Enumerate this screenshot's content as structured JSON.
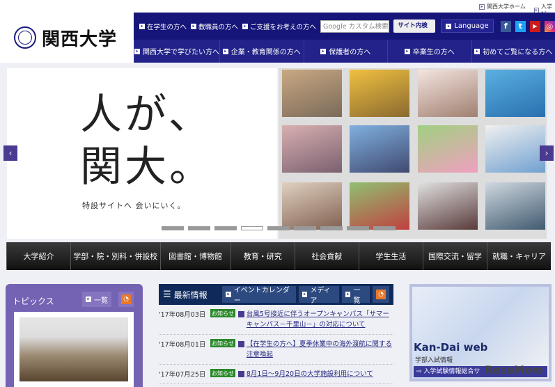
{
  "top_links": [
    "関西大学ホーム",
    "入学試"
  ],
  "logo": {
    "text": "関西大学"
  },
  "nav1": {
    "links": [
      "在学生の方へ",
      "教職員の方へ",
      "ご支援をお考えの方へ"
    ],
    "search_placeholder": "Google カスタム検索",
    "search_button": "サイト内検索",
    "language": "Language",
    "social": [
      "f",
      "t",
      "▶",
      "◎"
    ]
  },
  "nav2": [
    "関西大学で学びたい方へ",
    "企業・教育関係の方へ",
    "保護者の方へ",
    "卒業生の方へ",
    "初めてご覧になる方へ"
  ],
  "hero": {
    "catch_line1": "人が、",
    "catch_line2": "関大。",
    "sub": "特設サイトへ 会いにいく。",
    "slide_count": 9,
    "active_slide": 4
  },
  "main_nav": [
    "大学紹介",
    "学部・院・別科・併設校",
    "図書館・博物館",
    "教育・研究",
    "社会貢献",
    "学生生活",
    "国際交流・留学",
    "就職・キャリア"
  ],
  "topics": {
    "title": "トピックス",
    "list": "一覧"
  },
  "news": {
    "title": "最新情報",
    "buttons": [
      "イベントカレンダー",
      "メディア",
      "一覧"
    ],
    "items": [
      {
        "date": "'17年08月03日",
        "tag": "お知らせ",
        "title": "台風5号接近に伴うオープンキャンパス「サマーキャンパス－千里山－」の対応について"
      },
      {
        "date": "'17年08月01日",
        "tag": "お知らせ",
        "title": "【在学生の方へ】夏季休業中の海外渡航に関する注意喚起"
      },
      {
        "date": "'17年07月25日",
        "tag": "お知らせ",
        "title": "8月1日～9月20日の大学施設利用について"
      }
    ]
  },
  "banner": {
    "title": "Kan-Dai web",
    "sub": "学部入試情報",
    "link": "入学試験情報総合サ",
    "watermark": "ReseMom"
  }
}
